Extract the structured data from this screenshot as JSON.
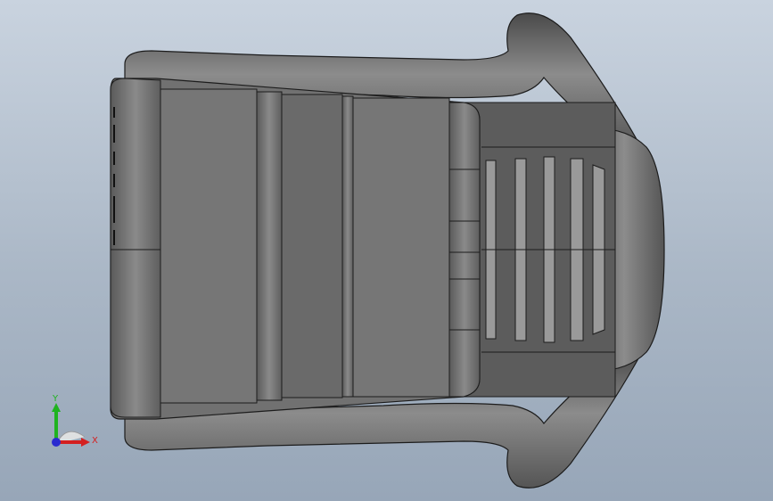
{
  "viewport": {
    "colors": {
      "bg_top": "#c9d3df",
      "bg_bottom": "#97a6b8",
      "model": "#6f6f6f",
      "edge": "#1c1c1c"
    }
  },
  "triad": {
    "y_label": "Y",
    "x_label": "X",
    "colors": {
      "y": "#1fb31f",
      "x": "#d42020",
      "z": "#2a2ad0"
    }
  }
}
